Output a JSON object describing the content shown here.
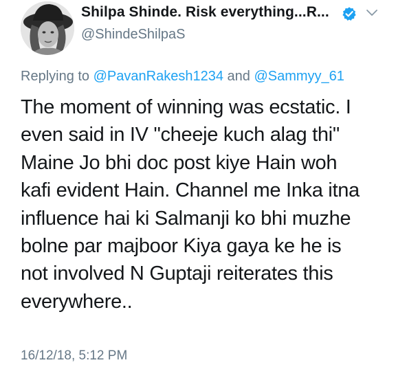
{
  "author": {
    "display_name": "Shilpa Shinde. Risk everything...R...",
    "handle": "@ShindeShilpaS",
    "avatar_icon": "profile-photo-woman-in-hat",
    "verified_icon": "verified-badge-icon",
    "verified_color": "#1da1f2"
  },
  "menu": {
    "icon": "chevron-down-icon"
  },
  "reply": {
    "prefix": "Replying to",
    "mention_1": "@PavanRakesh1234",
    "conjunction": "and",
    "mention_2": "@Sammyy_61"
  },
  "tweet": {
    "lines": [
      "The moment of winning was ecstatic. I",
      "even said in IV \"cheeje kuch alag thi\"",
      "Maine Jo bhi doc post kiye Hain woh",
      "kafi evident Hain. Channel me Inka itna",
      "influence hai ki Salmanji ko bhi muzhe",
      "bolne par majboor Kiya gaya ke he is",
      "not involved N Guptaji reiterates this",
      "everywhere.."
    ],
    "timestamp": "16/12/18, 5:12 PM"
  },
  "colors": {
    "text_primary": "#14171a",
    "text_secondary": "#657786",
    "link": "#1da1f2"
  }
}
